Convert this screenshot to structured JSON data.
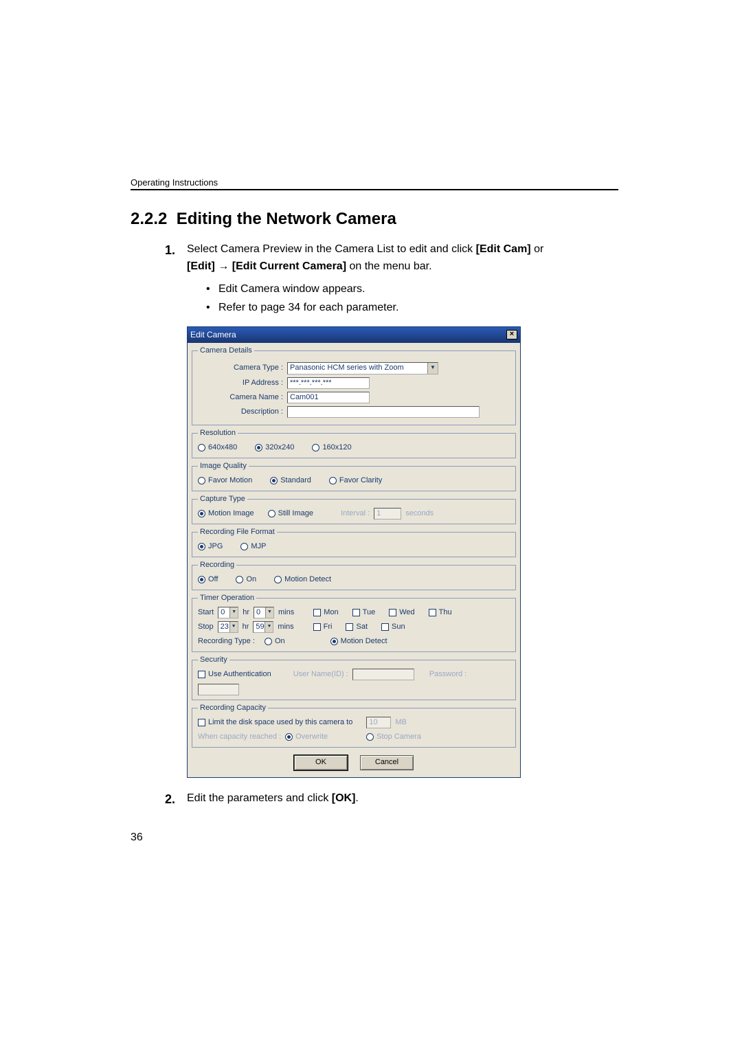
{
  "header": {
    "running_head": "Operating Instructions"
  },
  "section": {
    "number": "2.2.2",
    "title": "Editing the Network Camera"
  },
  "step1": {
    "part1": "Select Camera Preview in the Camera List to edit and click ",
    "bold1": "[Edit Cam]",
    "part2": " or ",
    "bold2": "[Edit]",
    "arrow": " → ",
    "bold3": "[Edit Current Camera]",
    "part3": " on the menu bar.",
    "bullets": [
      "Edit Camera window appears.",
      "Refer to page 34 for each parameter."
    ]
  },
  "step2": {
    "part1": "Edit the parameters and click ",
    "bold1": "[OK]",
    "part2": "."
  },
  "page_number": "36",
  "dlg": {
    "title": "Edit Camera",
    "close_glyph": "×",
    "drop_glyph": "▼",
    "details": {
      "legend": "Camera Details",
      "type_label": "Camera Type :",
      "type_value": "Panasonic HCM series with Zoom",
      "ip_label": "IP Address :",
      "ip_value": "***.***.***.***",
      "name_label": "Camera Name :",
      "name_value": "Cam001",
      "desc_label": "Description :",
      "desc_value": ""
    },
    "resolution": {
      "legend": "Resolution",
      "o1": "640x480",
      "o2": "320x240",
      "o3": "160x120"
    },
    "quality": {
      "legend": "Image Quality",
      "o1": "Favor Motion",
      "o2": "Standard",
      "o3": "Favor Clarity"
    },
    "capture": {
      "legend": "Capture Type",
      "o1": "Motion Image",
      "o2": "Still Image",
      "interval_label": "Interval :",
      "interval_value": "1",
      "interval_unit": "seconds"
    },
    "format": {
      "legend": "Recording File Format",
      "o1": "JPG",
      "o2": "MJP"
    },
    "recording": {
      "legend": "Recording",
      "o1": "Off",
      "o2": "On",
      "o3": "Motion Detect"
    },
    "timer": {
      "legend": "Timer Operation",
      "start": "Start",
      "stop": "Stop",
      "hr": "hr",
      "mins": "mins",
      "start_hr": "0",
      "start_min": "0",
      "stop_hr": "23",
      "stop_min": "59",
      "days": {
        "mon": "Mon",
        "tue": "Tue",
        "wed": "Wed",
        "thu": "Thu",
        "fri": "Fri",
        "sat": "Sat",
        "sun": "Sun"
      },
      "rec_type_label": "Recording Type :",
      "rec_o1": "On",
      "rec_o2": "Motion Detect"
    },
    "security": {
      "legend": "Security",
      "use_auth": "Use Authentication",
      "user_label": "User Name(ID) :",
      "pass_label": "Password :"
    },
    "capacity": {
      "legend": "Recording Capacity",
      "limit_label": "Limit the disk space used by this camera to",
      "limit_value": "10",
      "unit": "MB",
      "when_label": "When capacity reached :",
      "o1": "Overwrite",
      "o2": "Stop Camera"
    },
    "buttons": {
      "ok": "OK",
      "cancel": "Cancel"
    }
  }
}
